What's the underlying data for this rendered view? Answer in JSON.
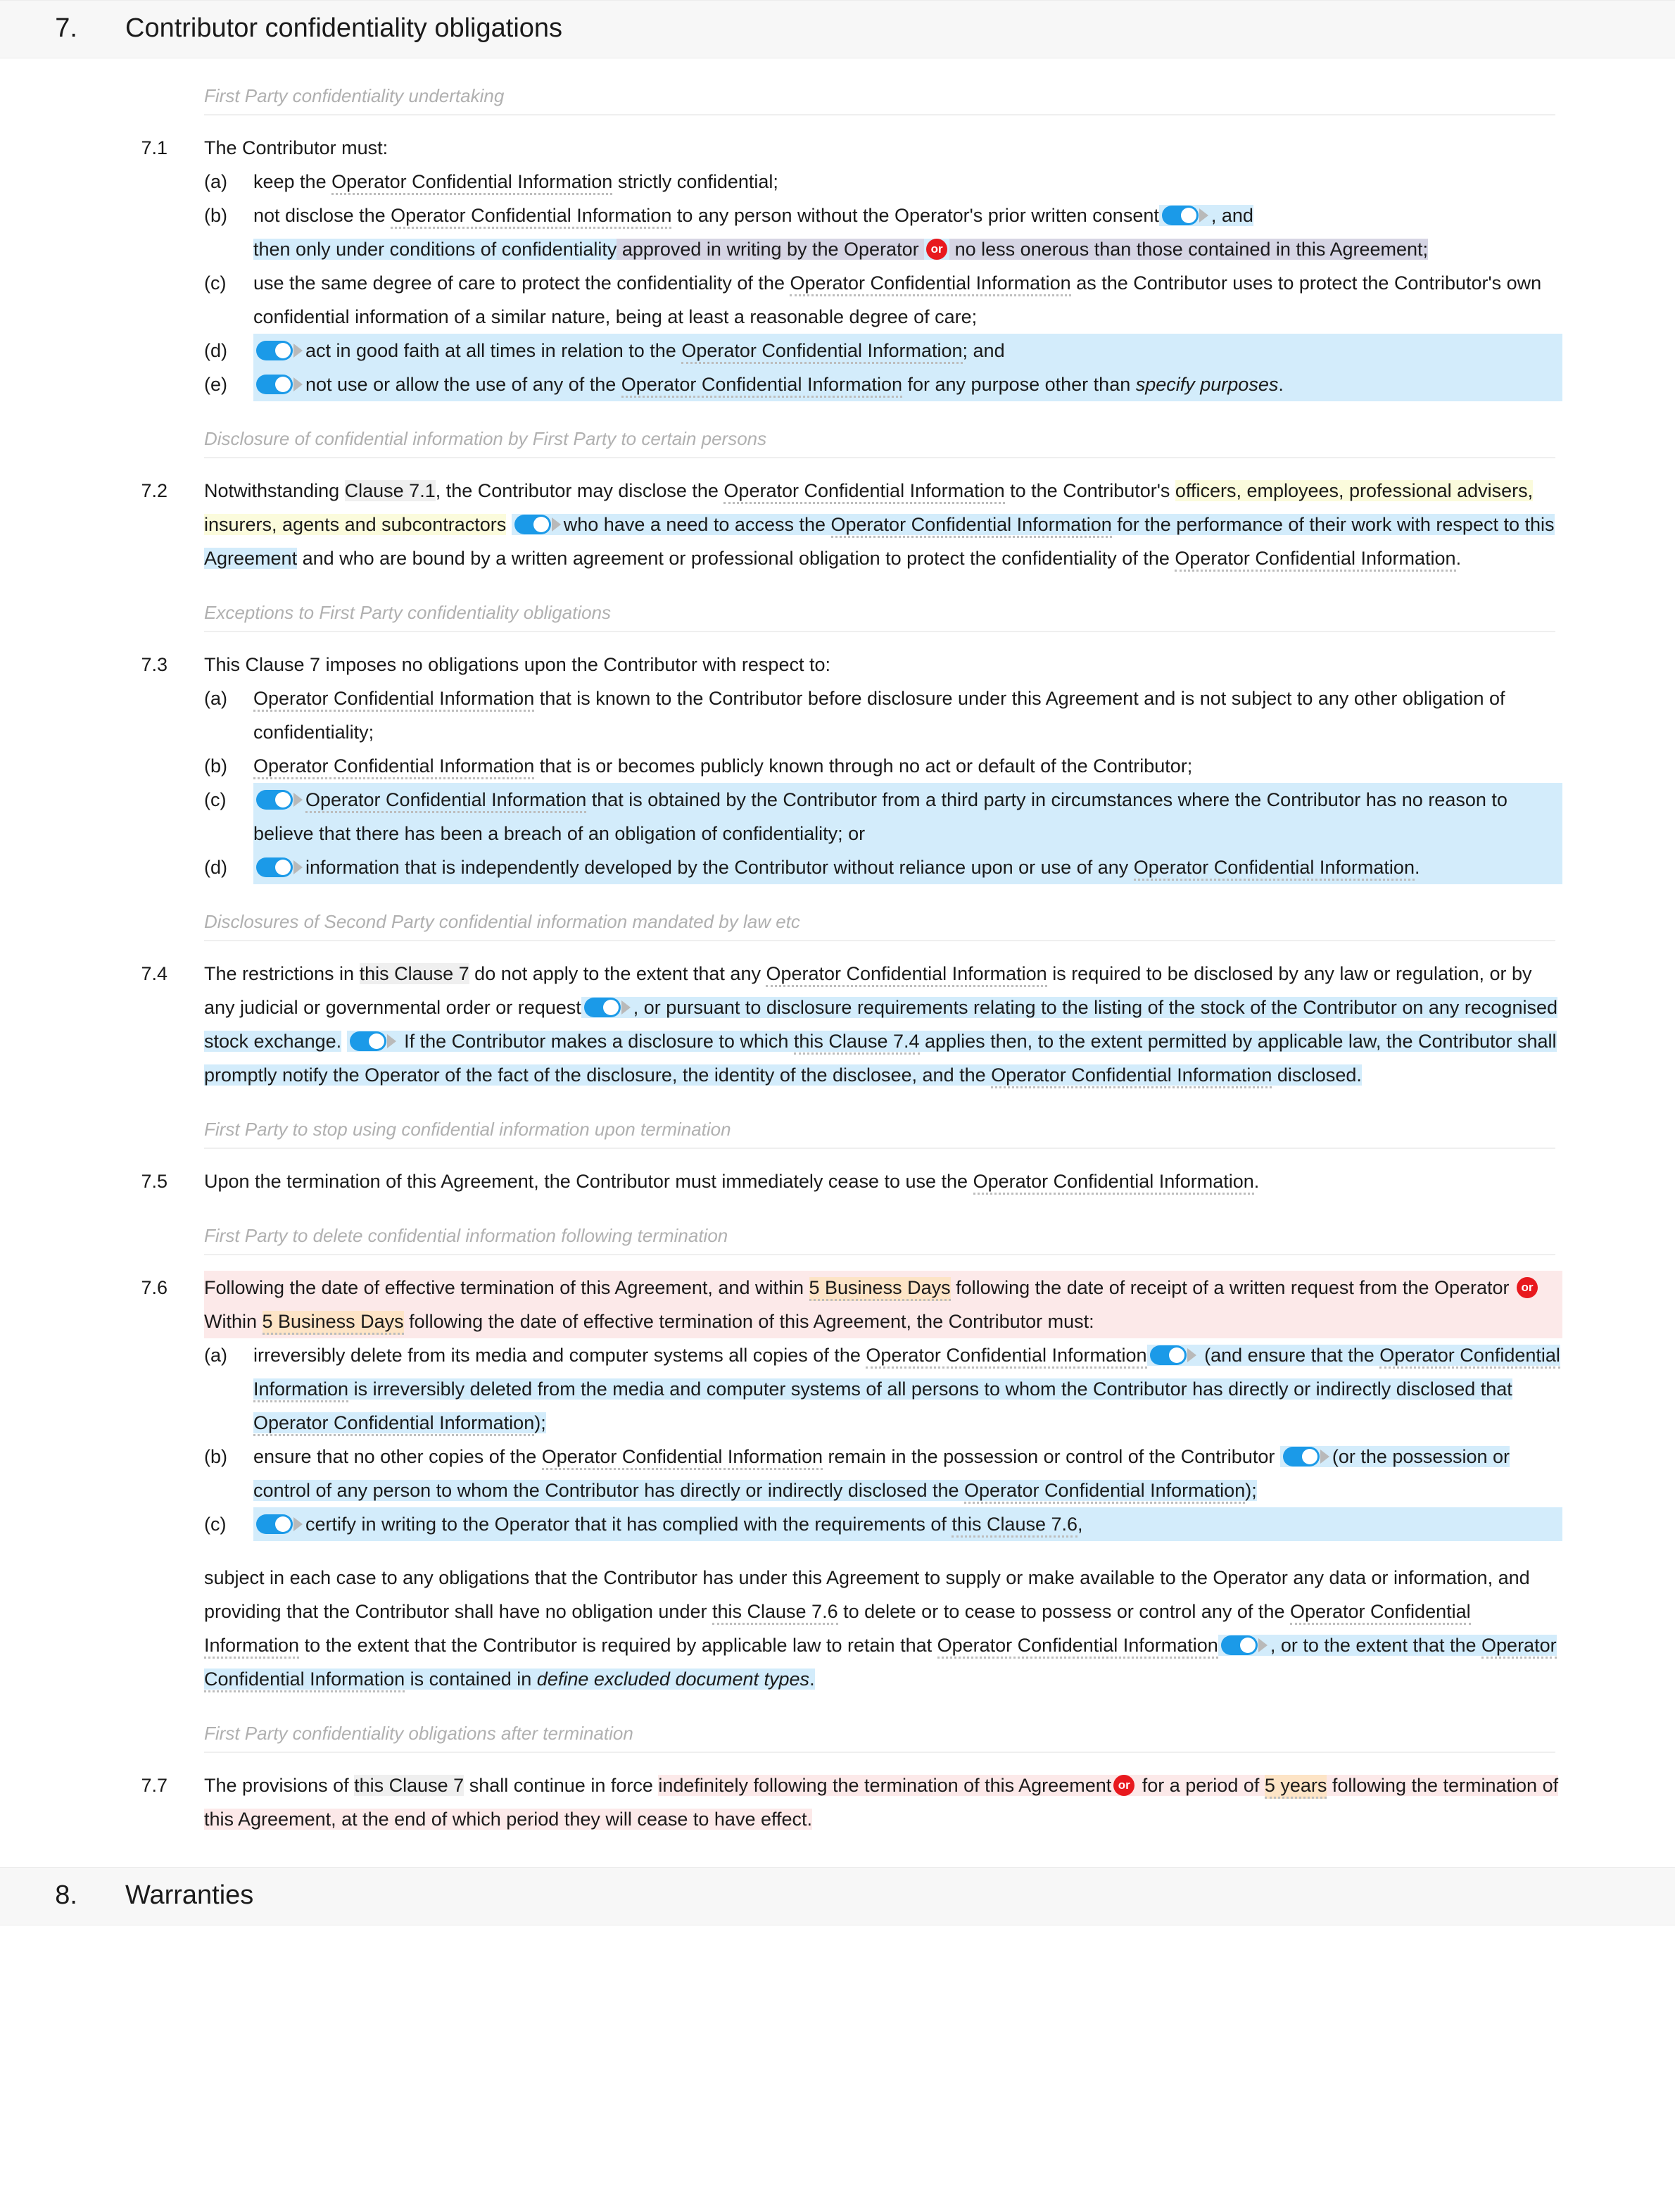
{
  "document": {
    "sections": [
      {
        "number": "7.",
        "title": "Contributor confidentiality obligations"
      },
      {
        "number": "8.",
        "title": "Warranties"
      }
    ]
  },
  "subheadings": {
    "s1": "First Party confidentiality undertaking",
    "s2": "Disclosure of confidential information by First Party to certain persons",
    "s3": "Exceptions to First Party confidentiality obligations",
    "s4": "Disclosures of Second Party confidential information mandated by law etc",
    "s5": "First Party to stop using confidential information upon termination",
    "s6": "First Party to delete confidential information following termination",
    "s7": "First Party confidentiality obligations after termination"
  },
  "clauses": {
    "c71": {
      "number": "7.1",
      "lead": "The Contributor must:",
      "items": {
        "a": {
          "label": "(a)",
          "t1": "keep the ",
          "term": "Operator Confidential Information",
          "t2": " strictly confidential;"
        },
        "b": {
          "label": "(b)",
          "t1": "not disclose the ",
          "term1": "Operator Confidential Information",
          "t2": " to any person without the Operator's prior written consent",
          "t3": ", and",
          "t4": "then only under conditions of confidentiality",
          "t5": " approved in writing by the Operator ",
          "t6": " no less onerous than those contained in this Agreement;"
        },
        "c": {
          "label": "(c)",
          "t1": "use the same degree of care to protect the confidentiality of the ",
          "term": "Operator Confidential Information",
          "t2": " as the Contributor uses to protect the Contributor's own confidential information of a similar nature, being at least a reasonable degree of care;"
        },
        "d": {
          "label": "(d)",
          "t1": "act in good faith at all times in relation to the ",
          "term": "Operator Confidential Information",
          "t2": "; and"
        },
        "e": {
          "label": "(e)",
          "t1": "not use or allow the use of any of the ",
          "term": "Operator Confidential Information",
          "t2": " for any purpose other than ",
          "placeholder": "specify purposes",
          "t3": "."
        }
      }
    },
    "c72": {
      "number": "7.2",
      "t1": "Notwithstanding ",
      "ref": "Clause 7.1",
      "t2": ", the Contributor may disclose the ",
      "term1": "Operator Confidential Information",
      "t3": " to the Contributor's ",
      "hl1": "officers, employees, professional advisers, insurers, agents and subcontractors",
      "t4": "who have a need to access the ",
      "term2": "Operator Confidential Information",
      "t5": " for the performance of their work with respect to this Agreement",
      "t6": " and who are bound by a written agreement or professional obligation to protect the confidentiality of the ",
      "term3": "Operator Confidential Information",
      "t7": "."
    },
    "c73": {
      "number": "7.3",
      "lead": "This Clause 7 imposes no obligations upon the Contributor with respect to:",
      "items": {
        "a": {
          "label": "(a)",
          "term": "Operator Confidential Information",
          "t1": " that is known to the Contributor before disclosure under this Agreement and is not subject to any other obligation of confidentiality;"
        },
        "b": {
          "label": "(b)",
          "term": "Operator Confidential Information",
          "t1": " that is or becomes publicly known through no act or default of the Contributor;"
        },
        "c": {
          "label": "(c)",
          "term": "Operator Confidential Information",
          "t1": " that is obtained by the Contributor from a third party in circumstances where the Contributor has no reason to believe that there has been a breach of an obligation of confidentiality; or"
        },
        "d": {
          "label": "(d)",
          "t1": "information that is independently developed by the Contributor without reliance upon or use of any ",
          "term": "Operator Confidential Information",
          "t2": "."
        }
      }
    },
    "c74": {
      "number": "7.4",
      "t1": "The restrictions in ",
      "ref1": "this Clause 7",
      "t2": " do not apply to the extent that any ",
      "term1": "Operator Confidential Information",
      "t3": " is required to be disclosed by any law or regulation, or by any judicial or governmental order or request",
      "t4": ", or pursuant to disclosure requirements relating to the listing of the stock of the Contributor on any recognised stock exchange.",
      "t5": " If the Contributor makes a disclosure to which ",
      "ref2": "this Clause 7.4",
      "t6": " applies then, to the extent permitted by applicable law, the Contributor shall promptly notify the Operator of the fact of the disclosure, the identity of the disclosee, and the ",
      "term2": "Operator Confidential Information",
      "t7": " disclosed."
    },
    "c75": {
      "number": "7.5",
      "t1": "Upon the termination of this Agreement, the Contributor must immediately cease to use the ",
      "term": "Operator Confidential Information",
      "t2": "."
    },
    "c76": {
      "number": "7.6",
      "t1": "Following the date of effective termination of this Agreement, and within ",
      "days1": "5 Business Days",
      "t2": " following the date of receipt of a written request from the Operator ",
      "t3": " Within ",
      "days2": "5 Business Days",
      "t4": " following the date of effective termination of this Agreement, the Contributor must:",
      "items": {
        "a": {
          "label": "(a)",
          "t1": "irreversibly delete from its media and computer systems all copies of the ",
          "term1": "Operator Confidential Information",
          "t2": " (and ensure that the ",
          "term2": "Operator Confidential Information",
          "t3": " is irreversibly deleted from the media and computer systems of all persons to whom the Contributor has directly or indirectly disclosed that ",
          "term3": "Operator Confidential Information",
          "t4": ");"
        },
        "b": {
          "label": "(b)",
          "t1": "ensure that no other copies of the ",
          "term1": "Operator Confidential Information",
          "t2": " remain in the possession or control of the Contributor",
          "t3": "(or the possession or control of any person to whom the Contributor has directly or indirectly disclosed the ",
          "term2": "Operator Confidential Information",
          "t4": ");"
        },
        "c": {
          "label": "(c)",
          "t1": "certify in writing to the Operator that it has complied with the requirements of ",
          "ref": "this Clause 7.6",
          "t2": ","
        }
      },
      "tail": {
        "t1": "subject in each case to any obligations that the Contributor has under this Agreement to supply or make available to the Operator any data or information, and providing that the Contributor shall have no obligation under ",
        "ref": "this Clause 7.6",
        "t2": " to delete or to cease to possess or control any of the ",
        "term1": "Operator Confidential Information",
        "t3": " to the extent that the Contributor is required by applicable law to retain that ",
        "term2": "Operator Confidential Information",
        "t4": ", or to the extent that the ",
        "term3": "Operator Confidential Information",
        "t5": " is contained in ",
        "placeholder": "define excluded document types",
        "t6": "."
      }
    },
    "c77": {
      "number": "7.7",
      "t1": "The provisions of ",
      "ref": "this Clause 7",
      "t2": " shall continue in force ",
      "hl1": "indefinitely following the termination of this Agreement",
      "t3": " for a period of ",
      "years": "5 years",
      "t4": " following the termination of this Agreement, at the end of which period they will cease to have effect."
    }
  },
  "icons": {
    "toggle": "toggle-switch-on",
    "or_badge": "or-badge",
    "arrow": "play-arrow-icon"
  },
  "colors": {
    "toggle_on": "#1b9ae8",
    "or_badge": "#e8191e",
    "highlight_blue": "#d3ecfb",
    "highlight_lavender": "#d6d5e4",
    "highlight_cream": "#fbfbdc",
    "highlight_pink": "#fce9e9",
    "highlight_orange": "#fde4c6",
    "highlight_grey": "#efefef"
  }
}
